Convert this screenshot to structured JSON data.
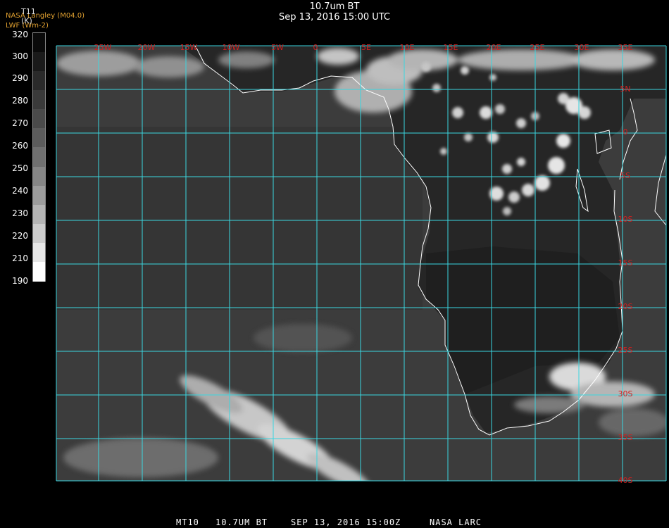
{
  "header": {
    "title": "10.7um BT",
    "subtitle": "Sep 13, 2016 15:00 UTC",
    "credit_line1": "NASA Langley (M04.0)",
    "credit_line2": "LWF (Wm-2)"
  },
  "colorbar": {
    "variable": "T11",
    "unit": "(K)",
    "labels": [
      "320",
      "300",
      "290",
      "280",
      "270",
      "260",
      "250",
      "240",
      "230",
      "220",
      "210",
      "190"
    ]
  },
  "map": {
    "lon_labels": [
      "25W",
      "20W",
      "15W",
      "10W",
      "5W",
      "0",
      "5E",
      "10E",
      "15E",
      "20E",
      "25E",
      "30E",
      "35E"
    ],
    "lat_labels": [
      "5N",
      "0",
      "5S",
      "10S",
      "15S",
      "20S",
      "25S",
      "30S",
      "35S",
      "40S"
    ],
    "grid_color": "#3ad6e0",
    "label_color": "#d02020",
    "coast_color": "#ffffff"
  },
  "footer": {
    "sat": "MT10",
    "channel": "10.7UM BT",
    "datetime": "SEP 13, 2016 15:00Z",
    "source": "NASA LARC"
  }
}
